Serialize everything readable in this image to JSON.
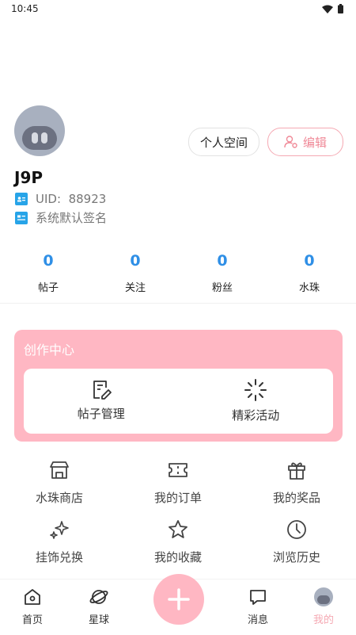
{
  "status_bar": {
    "time": "10:45"
  },
  "profile": {
    "space_button": "个人空间",
    "edit_button": "编辑",
    "username": "J9P",
    "uid_label": "UID:",
    "uid_value": "88923",
    "signature": "系统默认签名"
  },
  "stats": [
    {
      "value": "0",
      "label": "帖子"
    },
    {
      "value": "0",
      "label": "关注"
    },
    {
      "value": "0",
      "label": "粉丝"
    },
    {
      "value": "0",
      "label": "水珠"
    }
  ],
  "creation_center": {
    "title": "创作中心",
    "items": [
      {
        "label": "帖子管理",
        "icon": "edit-document-icon"
      },
      {
        "label": "精彩活动",
        "icon": "loading-spinner-icon"
      }
    ]
  },
  "menu": [
    {
      "label": "水珠商店",
      "icon": "store-icon"
    },
    {
      "label": "我的订单",
      "icon": "ticket-icon"
    },
    {
      "label": "我的奖品",
      "icon": "gift-icon"
    },
    {
      "label": "挂饰兑换",
      "icon": "sparkle-icon"
    },
    {
      "label": "我的收藏",
      "icon": "star-icon"
    },
    {
      "label": "浏览历史",
      "icon": "clock-icon"
    }
  ],
  "tabbar": {
    "home": "首页",
    "planet": "星球",
    "messages": "消息",
    "mine": "我的"
  },
  "colors": {
    "accent_pink": "#ffb7c3",
    "stat_blue": "#2f8fe6",
    "info_blue": "#27a4e8"
  }
}
